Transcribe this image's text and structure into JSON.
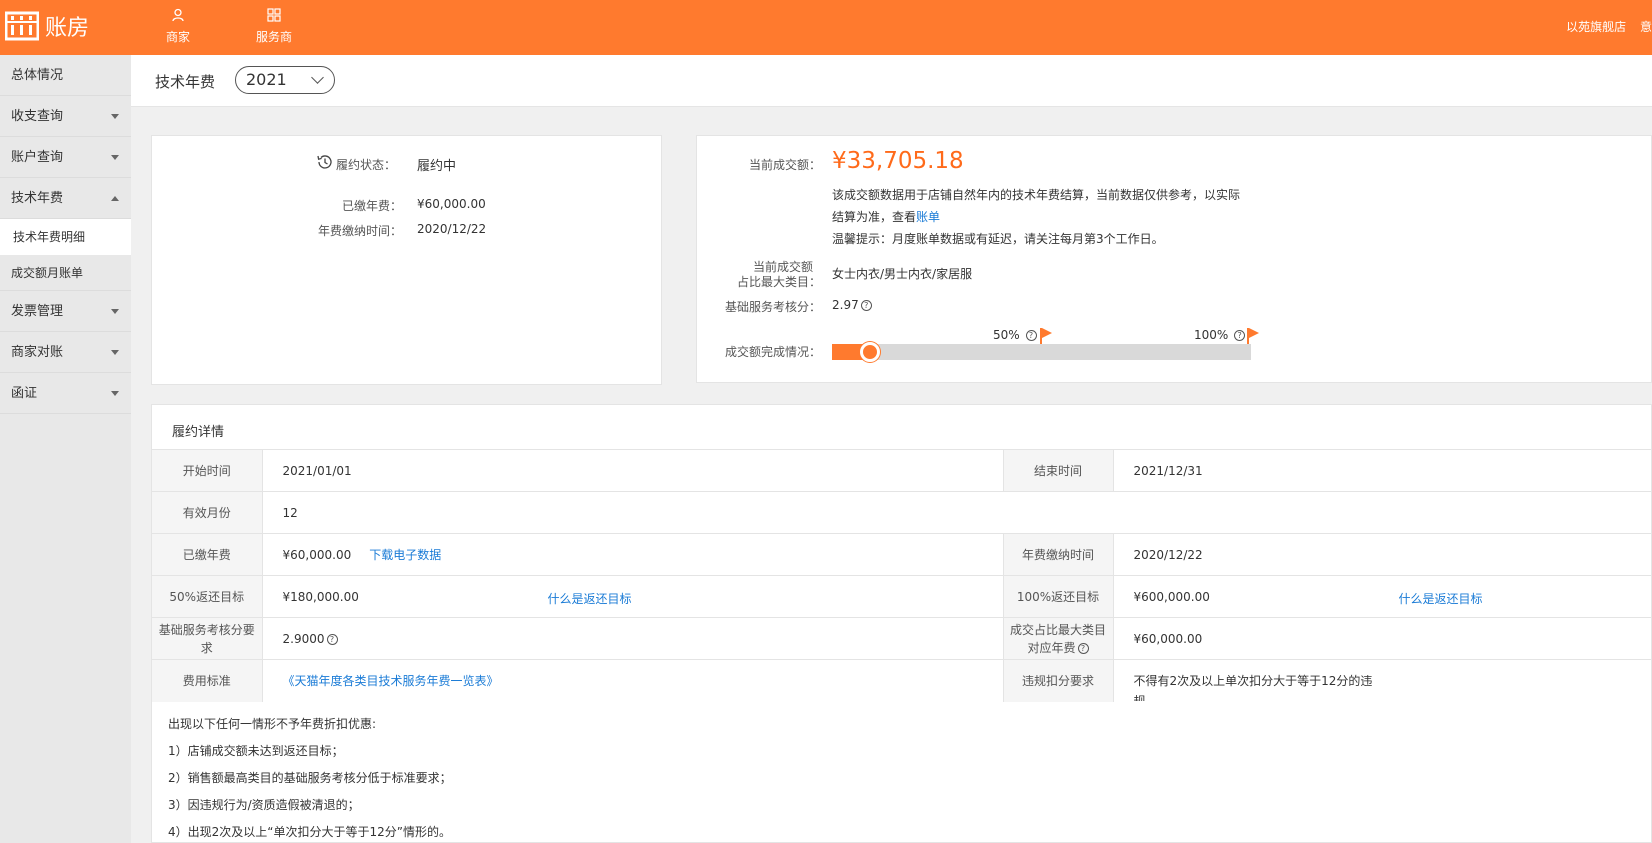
{
  "app": {
    "logo_text": "账房",
    "store_name": "以苑旗舰店",
    "right_cut": "意"
  },
  "topnav": [
    {
      "label": "商家",
      "icon": "user-icon"
    },
    {
      "label": "服务商",
      "icon": "grid-icon"
    }
  ],
  "sidebar": {
    "items": [
      {
        "label": "总体情况"
      },
      {
        "label": "收支查询"
      },
      {
        "label": "账户查询"
      },
      {
        "label": "技术年费"
      },
      {
        "label": "技术年费明细"
      },
      {
        "label": "成交额月账单"
      },
      {
        "label": "发票管理"
      },
      {
        "label": "商家对账"
      },
      {
        "label": "函证"
      }
    ]
  },
  "header": {
    "title": "技术年费",
    "year": "2021"
  },
  "left_card": {
    "status_label": "履约状态：",
    "status_value": "履约中",
    "paid_label": "已缴年费：",
    "paid_value": "¥60,000.00",
    "paydate_label": "年费缴纳时间：",
    "paydate_value": "2020/12/22"
  },
  "right_card": {
    "current_label": "当前成交额：",
    "current_value": "¥33,705.18",
    "note1": "该成交额数据用于店铺自然年内的技术年费结算，当前数据仅供参考，以实际",
    "note2_prefix": "结算为准，查看",
    "note2_link": "账单",
    "note3": "温馨提示：月度账单数据或有延迟，请关注每月第3个工作日。",
    "category_label_1": "当前成交额",
    "category_label_2": "占比最大类目：",
    "category_value": "女士内衣/男士内衣/家居服",
    "score_label": "基础服务考核分：",
    "score_value": "2.97",
    "progress_label": "成交额完成情况：",
    "progress_fraction": 0.09,
    "mark_50": "50%",
    "mark_100": "100%",
    "accent_color": "#ff7a2e"
  },
  "detail": {
    "title": "履约详情",
    "rows": {
      "start_label": "开始时间",
      "start_value": "2021/01/01",
      "end_label": "结束时间",
      "end_value": "2021/12/31",
      "months_label": "有效月份",
      "months_value": "12",
      "paid_label": "已缴年费",
      "paid_value": "¥60,000.00",
      "download_link": "下载电子数据",
      "paydate_label": "年费缴纳时间",
      "paydate_value": "2020/12/22",
      "t50_label": "50%返还目标",
      "t50_value": "¥180,000.00",
      "t50_link": "什么是返还目标",
      "t100_label": "100%返还目标",
      "t100_value": "¥600,000.00",
      "t100_link": "什么是返还目标",
      "score_req_label_1": "基础服务考核分要",
      "score_req_label_2": "求",
      "score_req_value": "2.9000",
      "cat_fee_label_1": "成交占比最大类目",
      "cat_fee_label_2": "对应年费",
      "cat_fee_value": "¥60,000.00",
      "standard_label": "费用标准",
      "standard_link": "《天猫年度各类目技术服务年费一览表》",
      "penalty_label": "违规扣分要求",
      "penalty_value_1": "不得有2次及以上单次扣分大于等于12分的违",
      "penalty_value_2": "规"
    },
    "notes": [
      "出现以下任何一情形不予年费折扣优惠:",
      "1）店铺成交额未达到返还目标；",
      "2）销售额最高类目的基础服务考核分低于标准要求；",
      "3）因违规行为/资质造假被清退的；",
      "4）出现2次及以上“单次扣分大于等于12分”情形的。"
    ]
  }
}
